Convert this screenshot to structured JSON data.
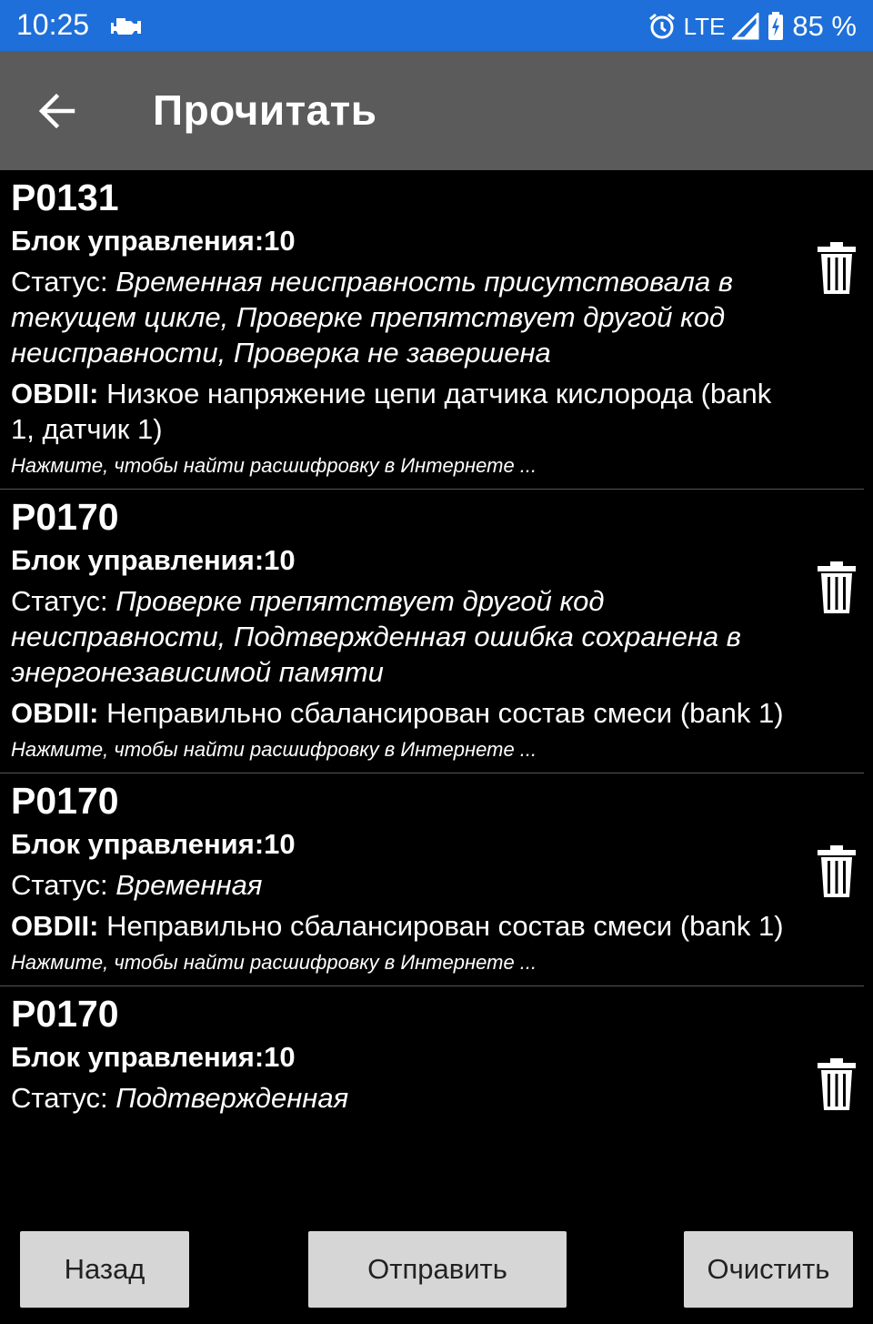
{
  "status_bar": {
    "time": "10:25",
    "network": "LTE",
    "battery": "85 %",
    "background": "#1e6fd9",
    "icons": [
      "engine-icon",
      "alarm-clock-icon",
      "signal-icon",
      "battery-charging-icon"
    ]
  },
  "app_bar": {
    "title": "Прочитать",
    "background": "#5b5b5b",
    "back_icon": "arrow-back-icon"
  },
  "errors": [
    {
      "code": "P0131",
      "control_unit": "Блок управления:10",
      "status_label": "Статус:",
      "status_text": "Временная неисправность присутствовала в текущем цикле, Проверке препятствует другой код неисправности, Проверка не завершена",
      "obd_label": "OBDII:",
      "obd_text": "Низкое напряжение цепи датчика кислорода (bank 1, датчик 1)",
      "hint": "Нажмите, чтобы найти расшифровку в Интернете ..."
    },
    {
      "code": "P0170",
      "control_unit": "Блок управления:10",
      "status_label": "Статус:",
      "status_text": "Проверке препятствует другой код неисправности, Подтвержденная ошибка сохранена в энергонезависимой памяти",
      "obd_label": "OBDII:",
      "obd_text": "Неправильно сбалансирован состав смеси (bank 1)",
      "hint": "Нажмите, чтобы найти расшифровку в Интернете ..."
    },
    {
      "code": "P0170",
      "control_unit": "Блок управления:10",
      "status_label": "Статус:",
      "status_text": "Временная",
      "obd_label": "OBDII:",
      "obd_text": "Неправильно сбалансирован состав смеси (bank 1)",
      "hint": "Нажмите, чтобы найти расшифровку в Интернете ..."
    },
    {
      "code": "P0170",
      "control_unit": "Блок управления:10",
      "status_label": "Статус:",
      "status_text": "Подтвержденная"
    }
  ],
  "buttons": {
    "back": "Назад",
    "send": "Отправить",
    "clear": "Очистить",
    "background": "#d6d6d6"
  }
}
